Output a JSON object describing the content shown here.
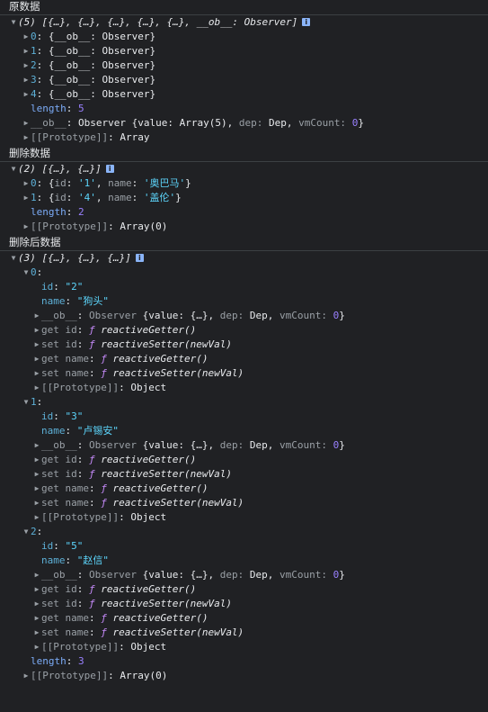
{
  "section1": {
    "label": "原数据",
    "summary": "(5) [{…}, {…}, {…}, {…}, {…}, __ob__: Observer]",
    "items": [
      {
        "index": "0",
        "text": "{__ob__: Observer}"
      },
      {
        "index": "1",
        "text": "{__ob__: Observer}"
      },
      {
        "index": "2",
        "text": "{__ob__: Observer}"
      },
      {
        "index": "3",
        "text": "{__ob__: Observer}"
      },
      {
        "index": "4",
        "text": "{__ob__: Observer}"
      }
    ],
    "length_key": "length",
    "length_value": "5",
    "ob_row": {
      "key": "__ob__",
      "type": "Observer",
      "open": "{value:",
      "value": "Array(5)",
      "dep_key": "dep:",
      "dep_val": "Dep",
      "vm_key": "vmCount:",
      "vm_val": "0",
      "close": "}"
    },
    "prototype": {
      "key": "[[Prototype]]",
      "value": "Array"
    }
  },
  "section2": {
    "label": "删除数据",
    "summary": "(2) [{…}, {…}]",
    "items": [
      {
        "index": "0",
        "id": "'1'",
        "name": "'奥巴马'"
      },
      {
        "index": "1",
        "id": "'4'",
        "name": "'盖伦'"
      }
    ],
    "length_key": "length",
    "length_value": "2",
    "prototype": {
      "key": "[[Prototype]]",
      "value": "Array(0)"
    }
  },
  "section3": {
    "label": "删除后数据",
    "summary": "(3) [{…}, {…}, {…}]",
    "objects": [
      {
        "index": "0",
        "id": "\"2\"",
        "name": "\"狗头\""
      },
      {
        "index": "1",
        "id": "\"3\"",
        "name": "\"卢锡安\""
      },
      {
        "index": "2",
        "id": "\"5\"",
        "name": "\"赵信\""
      }
    ],
    "ob": {
      "key": "__ob__",
      "type": "Observer",
      "open": "{value:",
      "value": "{…}",
      "dep_key": "dep:",
      "dep_val": "Dep",
      "vm_key": "vmCount:",
      "vm_val": "0",
      "close": "}"
    },
    "accessors": [
      {
        "key": "get id",
        "fn": "reactiveGetter()"
      },
      {
        "key": "set id",
        "fn": "reactiveSetter(newVal)"
      },
      {
        "key": "get name",
        "fn": "reactiveGetter()"
      },
      {
        "key": "set name",
        "fn": "reactiveSetter(newVal)"
      }
    ],
    "obj_prototype": {
      "key": "[[Prototype]]",
      "value": "Object"
    },
    "length_key": "length",
    "length_value": "3",
    "prototype": {
      "key": "[[Prototype]]",
      "value": "Array(0)"
    }
  },
  "labels": {
    "id_key": "id",
    "name_key": "name",
    "f_symbol": "ƒ",
    "info_icon": "i"
  }
}
